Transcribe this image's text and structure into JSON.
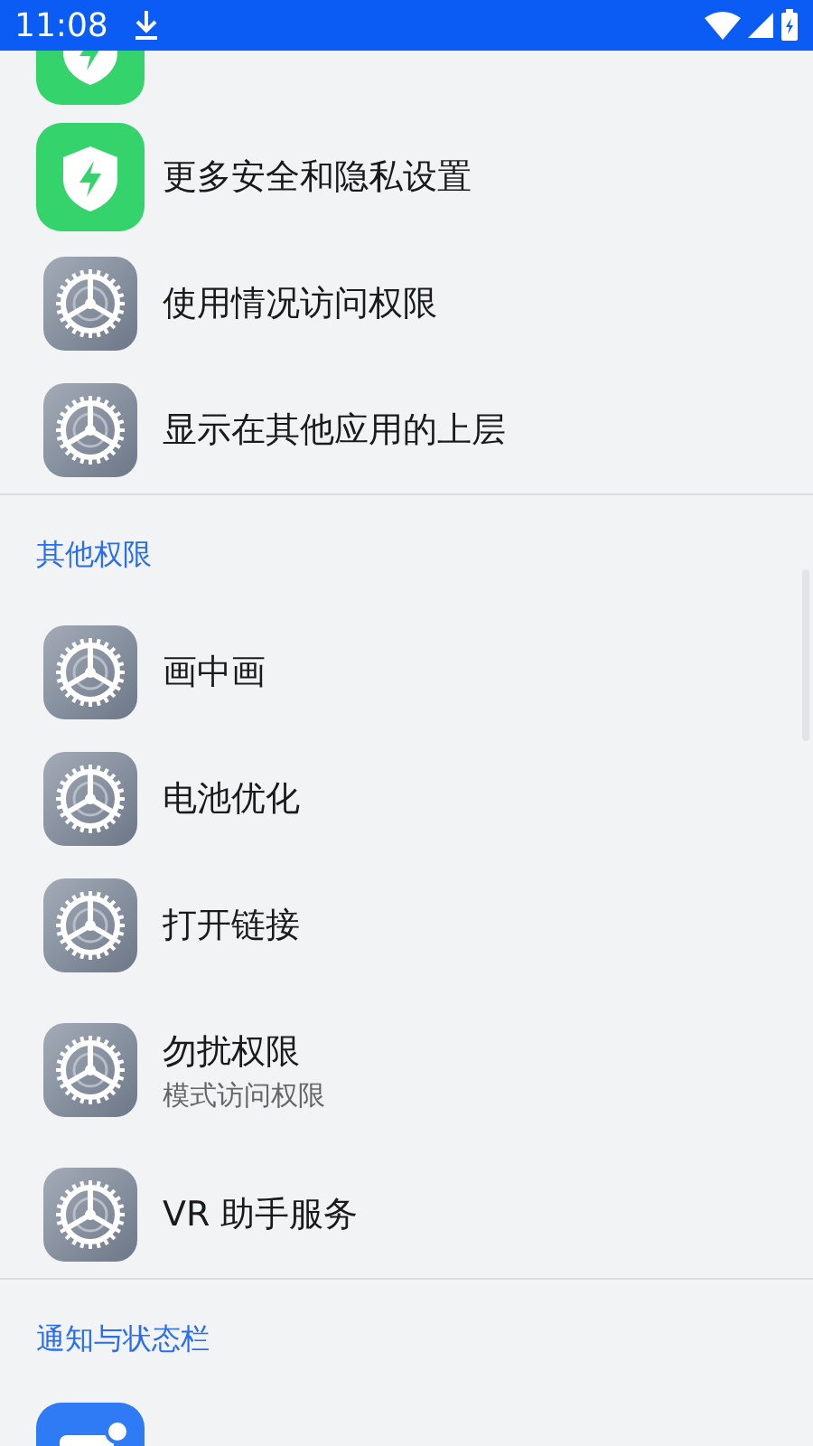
{
  "status_bar": {
    "time": "11:08"
  },
  "sections": [
    {
      "items": [
        {
          "kind": "shield"
        },
        {
          "kind": "shield",
          "title": "更多安全和隐私设置"
        },
        {
          "kind": "gear",
          "title": "使用情况访问权限"
        },
        {
          "kind": "gear",
          "title": "显示在其他应用的上层"
        }
      ]
    },
    {
      "header": "其他权限",
      "items": [
        {
          "kind": "gear",
          "title": "画中画"
        },
        {
          "kind": "gear",
          "title": "电池优化"
        },
        {
          "kind": "gear",
          "title": "打开链接"
        },
        {
          "kind": "gear",
          "title": "勿扰权限",
          "subtitle": "模式访问权限"
        },
        {
          "kind": "gear",
          "title": "VR 助手服务"
        }
      ]
    },
    {
      "header": "通知与状态栏",
      "items": [
        {
          "kind": "notification"
        }
      ]
    }
  ]
}
